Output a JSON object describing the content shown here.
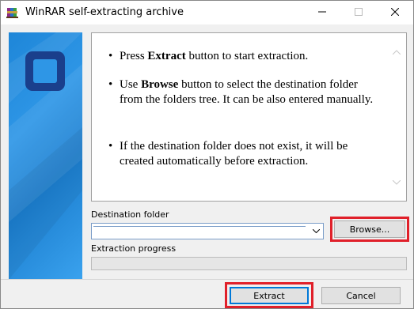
{
  "window": {
    "title": "WinRAR self-extracting archive"
  },
  "titlebar": {
    "icons": {
      "app": "winrar-books-icon",
      "minimize": "minimize-icon",
      "maximize": "maximize-icon",
      "close": "close-icon"
    }
  },
  "banner": {
    "color": "#1e86d8",
    "logo_icon": "square-logo-icon"
  },
  "instructions": {
    "items": [
      {
        "pre": "Press ",
        "bold": "Extract",
        "post": " button to start extraction."
      },
      {
        "pre": "Use ",
        "bold": "Browse",
        "post": " button to select the destination folder from the folders tree. It can be also entered manually."
      },
      {
        "pre": "If the destination folder does not exist, it will be created automatically before extraction.",
        "bold": "",
        "post": ""
      }
    ]
  },
  "destination": {
    "label": "Destination folder",
    "value": "",
    "browse_label": "Browse..."
  },
  "progress": {
    "label": "Extraction progress",
    "value": 0
  },
  "buttons": {
    "extract_label": "Extract",
    "cancel_label": "Cancel"
  },
  "highlight_color": "#e0202a"
}
